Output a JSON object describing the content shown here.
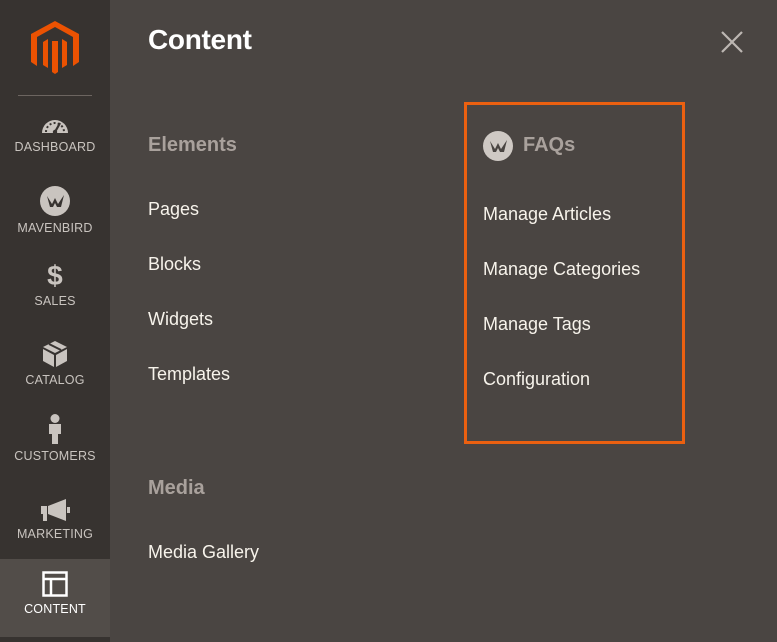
{
  "sidebar": {
    "items": [
      {
        "label": "DASHBOARD",
        "icon": "dashboard-icon"
      },
      {
        "label": "MAVENBIRD",
        "icon": "mavenbird-icon"
      },
      {
        "label": "SALES",
        "icon": "dollar-icon"
      },
      {
        "label": "CATALOG",
        "icon": "box-icon"
      },
      {
        "label": "CUSTOMERS",
        "icon": "person-icon"
      },
      {
        "label": "MARKETING",
        "icon": "megaphone-icon"
      },
      {
        "label": "CONTENT",
        "icon": "layout-icon",
        "active": true
      }
    ]
  },
  "panel": {
    "title": "Content",
    "close_icon": "close-icon"
  },
  "sections": {
    "elements": {
      "title": "Elements",
      "links": [
        "Pages",
        "Blocks",
        "Widgets",
        "Templates"
      ]
    },
    "media": {
      "title": "Media",
      "links": [
        "Media Gallery"
      ]
    },
    "faqs": {
      "title": "FAQs",
      "icon": "mavenbird-icon",
      "links": [
        "Manage Articles",
        "Manage Categories",
        "Manage Tags",
        "Configuration"
      ]
    }
  },
  "colors": {
    "sidebar_bg": "#373330",
    "panel_bg": "#4a4542",
    "active_bg": "#524d49",
    "highlight_border": "#eb6010",
    "brand_orange": "#eb5202"
  }
}
